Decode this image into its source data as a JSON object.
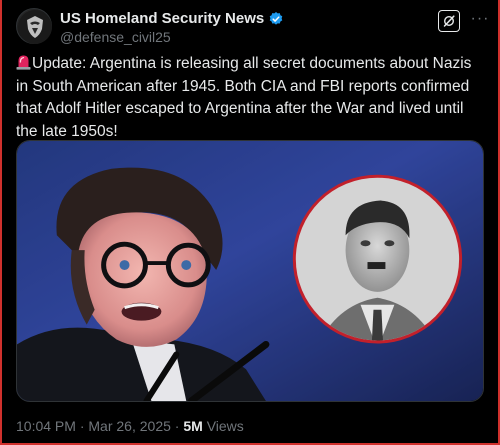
{
  "account": {
    "display_name": "US Homeland Security News",
    "handle": "@defense_civil25",
    "verified": true,
    "verified_color": "#1d9bf0",
    "avatar_icon": "shield-eagle-emblem"
  },
  "actions": {
    "grok_icon": "grok-icon",
    "more_icon": "more-dots-icon",
    "more_label": "···"
  },
  "tweet": {
    "emoji_icon": "police-siren-icon",
    "text": "Update: Argentina is releasing all secret documents about Nazis in South American after 1945. Both CIA and FBI reports confirmed that Adolf Hitler escaped to Argentina after the War and lived until the late 1950s!"
  },
  "media": {
    "type": "image",
    "description_icon": "photo-composite"
  },
  "meta": {
    "time": "10:04 PM",
    "separator": "·",
    "date": "Mar 26, 2025",
    "views_count": "5M",
    "views_label": "Views"
  },
  "colors": {
    "background": "#000000",
    "text": "#e7e9ea",
    "secondary_text": "#71767b",
    "frame_border": "#d0312d"
  }
}
